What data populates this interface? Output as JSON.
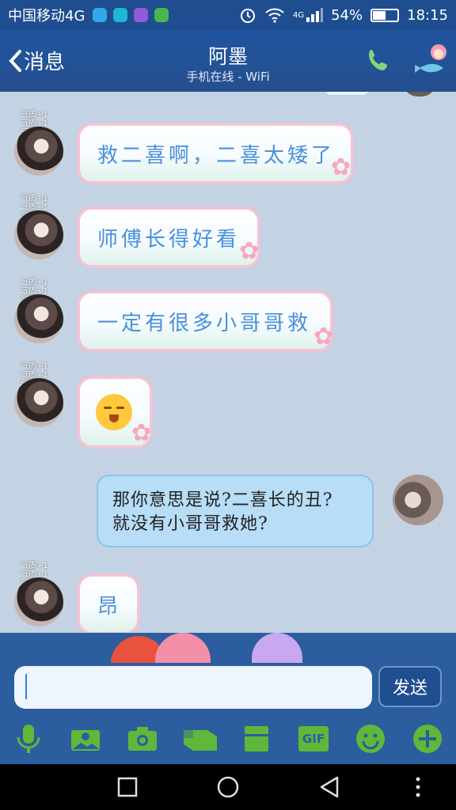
{
  "status_bar": {
    "carrier": "中国移动4G",
    "battery": "54%",
    "battery_level": 0.54,
    "time": "18:15",
    "network_badge": "4G"
  },
  "header": {
    "back_label": "消息",
    "title": "阿墨",
    "subtitle": "手机在线 - WiFi"
  },
  "avatar_badge": [
    "气质+1",
    "气质+1",
    "气质+1"
  ],
  "messages": [
    {
      "side": "left",
      "text": "救二喜啊，二喜太矮了"
    },
    {
      "side": "left",
      "text": "师傅长得好看"
    },
    {
      "side": "left",
      "text": "一定有很多小哥哥救"
    },
    {
      "side": "left",
      "text": "",
      "emoji": "shy-face-emoji"
    },
    {
      "side": "right",
      "lines": [
        "那你意思是说?二喜长的丑?",
        "就没有小哥哥救她?"
      ]
    },
    {
      "side": "left",
      "text": "昂"
    }
  ],
  "input": {
    "value": "",
    "send_label": "发送"
  },
  "toolbar": {
    "items": [
      "microphone-icon",
      "photo-icon",
      "camera-icon",
      "red-packet-icon",
      "file-icon",
      "gif-icon",
      "emoji-icon",
      "plus-icon"
    ],
    "gif_label": "GIF"
  },
  "colors": {
    "header_bg": "#2155a0",
    "chat_bg": "#c3d3e4",
    "bubble_text": "#4a90d9",
    "bubble_border": "#f6c4d6",
    "right_bubble_bg": "#b7ddf7",
    "toolbar_icon": "#5fb83a"
  }
}
